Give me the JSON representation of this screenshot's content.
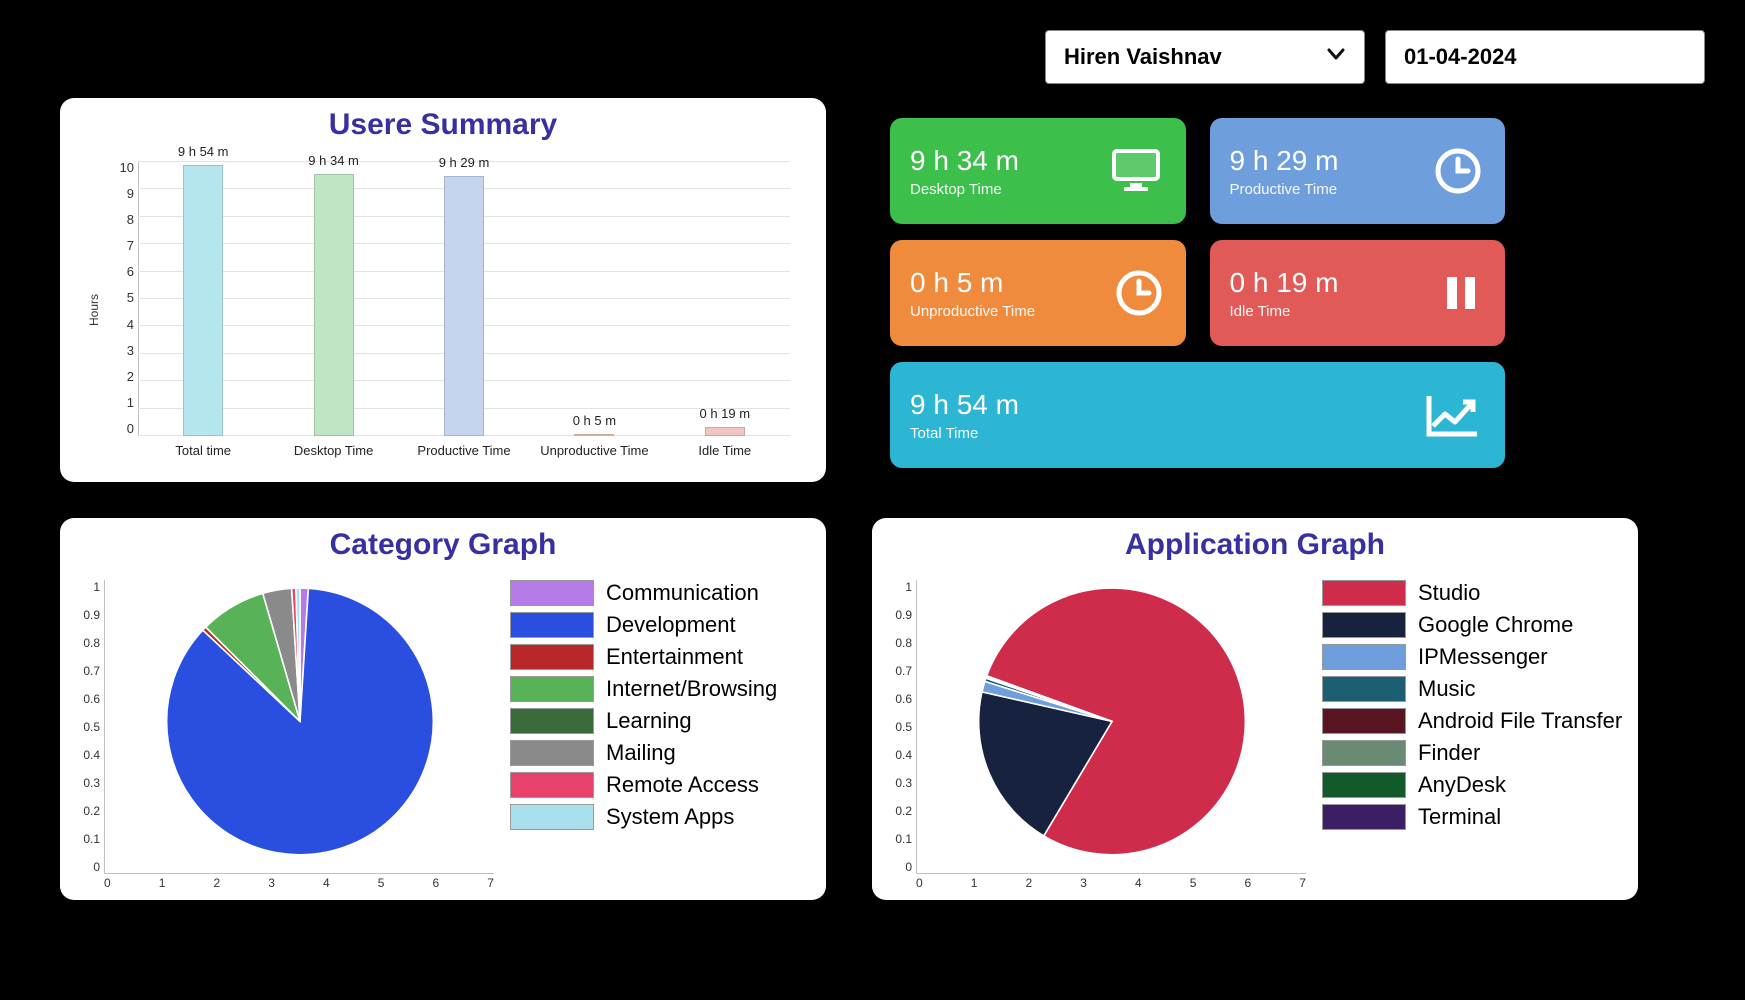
{
  "topbar": {
    "user": "Hiren Vaishnav",
    "date": "01-04-2024"
  },
  "tiles": {
    "desktop": {
      "value": "9 h 34 m",
      "label": "Desktop Time",
      "color": "#3cbf4b"
    },
    "productive": {
      "value": "9 h 29 m",
      "label": "Productive Time",
      "color": "#6f9edc"
    },
    "unproductive": {
      "value": "0 h 5 m",
      "label": "Unproductive Time",
      "color": "#f08a3c"
    },
    "idle": {
      "value": "0 h 19 m",
      "label": "Idle Time",
      "color": "#e25a57"
    },
    "total": {
      "value": "9 h 54 m",
      "label": "Total Time",
      "color": "#2db5d4"
    }
  },
  "user_summary": {
    "title": "Usere Summary",
    "ylabel": "Hours"
  },
  "category_graph": {
    "title": "Category Graph",
    "legend": [
      {
        "name": "Communication",
        "color": "#b57ce8"
      },
      {
        "name": "Development",
        "color": "#2a4fe0"
      },
      {
        "name": "Entertainment",
        "color": "#b82828"
      },
      {
        "name": "Internet/Browsing",
        "color": "#58b258"
      },
      {
        "name": "Learning",
        "color": "#3b6b3b"
      },
      {
        "name": "Mailing",
        "color": "#8a8a8a"
      },
      {
        "name": "Remote Access",
        "color": "#e8416b"
      },
      {
        "name": "System Apps",
        "color": "#a9e0ec"
      }
    ]
  },
  "application_graph": {
    "title": "Application Graph",
    "legend": [
      {
        "name": "Studio",
        "color": "#cf2c4b"
      },
      {
        "name": "Google Chrome",
        "color": "#17223f"
      },
      {
        "name": "IPMessenger",
        "color": "#6f9edc"
      },
      {
        "name": "Music",
        "color": "#1d5f72"
      },
      {
        "name": "Android File Transfer",
        "color": "#5a1522"
      },
      {
        "name": "Finder",
        "color": "#6b8a73"
      },
      {
        "name": "AnyDesk",
        "color": "#135a2b"
      },
      {
        "name": "Terminal",
        "color": "#3b1e63"
      }
    ]
  },
  "axis": {
    "y01": [
      "1",
      "0.9",
      "0.8",
      "0.7",
      "0.6",
      "0.5",
      "0.4",
      "0.3",
      "0.2",
      "0.1",
      "0"
    ],
    "x07": [
      "0",
      "1",
      "2",
      "3",
      "4",
      "5",
      "6",
      "7"
    ],
    "y010": [
      "10",
      "9",
      "8",
      "7",
      "6",
      "5",
      "4",
      "3",
      "2",
      "1",
      "0"
    ]
  },
  "chart_data": [
    {
      "id": "user_summary",
      "type": "bar",
      "title": "Usere Summary",
      "ylabel": "Hours",
      "ylim": [
        0,
        10
      ],
      "categories": [
        "Total time",
        "Desktop Time",
        "Productive Time",
        "Unproductive Time",
        "Idle Time"
      ],
      "values_hours": [
        9.9,
        9.57,
        9.48,
        0.083,
        0.317
      ],
      "value_labels": [
        "9 h 54 m",
        "9 h 34 m",
        "9 h 29 m",
        "0 h 5 m",
        "0 h 19 m"
      ],
      "bar_colors": [
        "#b5e5ee",
        "#bfe6c4",
        "#c5d5ee",
        "#f5cdb8",
        "#f1c5c4"
      ]
    },
    {
      "id": "category_graph",
      "type": "pie",
      "title": "Category Graph",
      "series": [
        {
          "name": "Communication",
          "value": 0.01,
          "color": "#b57ce8"
        },
        {
          "name": "Development",
          "value": 0.86,
          "color": "#2a4fe0"
        },
        {
          "name": "Entertainment",
          "value": 0.005,
          "color": "#b82828"
        },
        {
          "name": "Internet/Browsing",
          "value": 0.08,
          "color": "#58b258"
        },
        {
          "name": "Learning",
          "value": 0.0,
          "color": "#3b6b3b"
        },
        {
          "name": "Mailing",
          "value": 0.035,
          "color": "#8a8a8a"
        },
        {
          "name": "Remote Access",
          "value": 0.005,
          "color": "#e8416b"
        },
        {
          "name": "System Apps",
          "value": 0.005,
          "color": "#a9e0ec"
        }
      ]
    },
    {
      "id": "application_graph",
      "type": "pie",
      "title": "Application Graph",
      "series": [
        {
          "name": "Studio",
          "value": 0.78,
          "color": "#cf2c4b"
        },
        {
          "name": "Google Chrome",
          "value": 0.2,
          "color": "#17223f"
        },
        {
          "name": "IPMessenger",
          "value": 0.013,
          "color": "#6f9edc"
        },
        {
          "name": "Music",
          "value": 0.004,
          "color": "#1d5f72"
        },
        {
          "name": "Android File Transfer",
          "value": 0.001,
          "color": "#5a1522"
        },
        {
          "name": "Finder",
          "value": 0.001,
          "color": "#6b8a73"
        },
        {
          "name": "AnyDesk",
          "value": 0.001,
          "color": "#135a2b"
        },
        {
          "name": "Terminal",
          "value": 0.0,
          "color": "#3b1e63"
        }
      ]
    }
  ]
}
